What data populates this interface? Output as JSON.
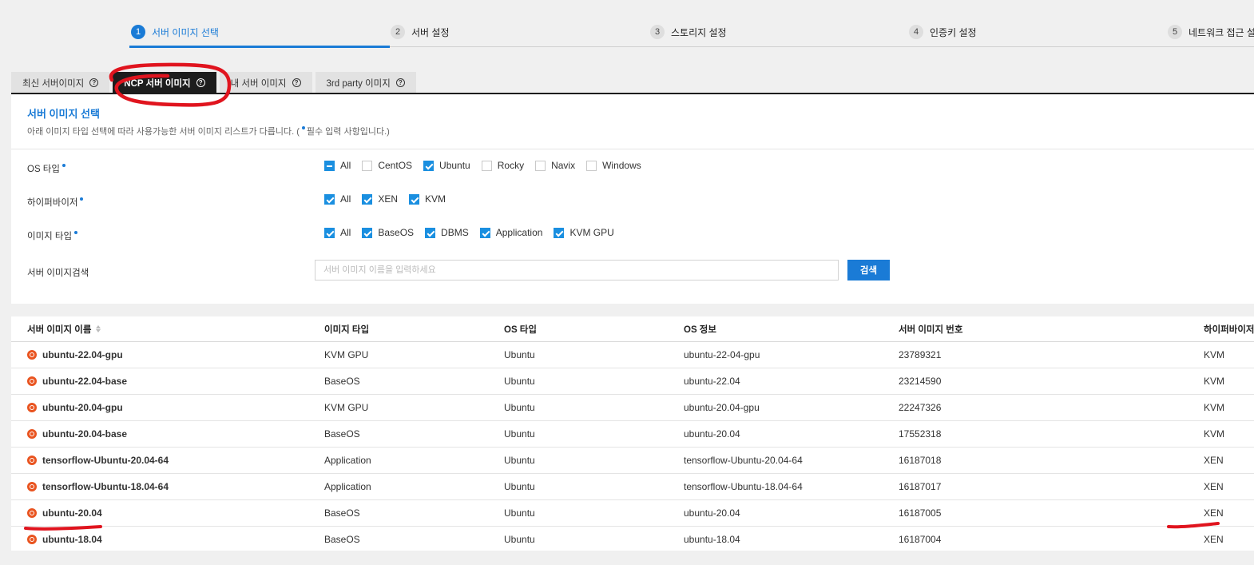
{
  "steps": [
    {
      "num": "1",
      "label": "서버 이미지 선택"
    },
    {
      "num": "2",
      "label": "서버 설정"
    },
    {
      "num": "3",
      "label": "스토리지 설정"
    },
    {
      "num": "4",
      "label": "인증키 설정"
    },
    {
      "num": "5",
      "label": "네트워크 접근 설정"
    }
  ],
  "tabs": [
    {
      "label": "최신 서버이미지"
    },
    {
      "label": "NCP 서버 이미지"
    },
    {
      "label": "내 서버 이미지"
    },
    {
      "label": "3rd party 이미지"
    }
  ],
  "panel": {
    "title": "서버 이미지 선택",
    "desc_prefix": "아래 이미지 타입 선택에 따라 사용가능한 서버 이미지 리스트가 다릅니다. (",
    "desc_suffix": "필수 입력 사항입니다.)"
  },
  "filters": {
    "os_type": {
      "label": "OS 타입",
      "options": [
        {
          "label": "All",
          "state": "partial"
        },
        {
          "label": "CentOS",
          "state": "off"
        },
        {
          "label": "Ubuntu",
          "state": "on"
        },
        {
          "label": "Rocky",
          "state": "off"
        },
        {
          "label": "Navix",
          "state": "off"
        },
        {
          "label": "Windows",
          "state": "off"
        }
      ]
    },
    "hypervisor": {
      "label": "하이퍼바이저",
      "options": [
        {
          "label": "All",
          "state": "on"
        },
        {
          "label": "XEN",
          "state": "on"
        },
        {
          "label": "KVM",
          "state": "on"
        }
      ]
    },
    "image_type": {
      "label": "이미지 타입",
      "options": [
        {
          "label": "All",
          "state": "on"
        },
        {
          "label": "BaseOS",
          "state": "on"
        },
        {
          "label": "DBMS",
          "state": "on"
        },
        {
          "label": "Application",
          "state": "on"
        },
        {
          "label": "KVM GPU",
          "state": "on"
        }
      ]
    },
    "search": {
      "label": "서버 이미지검색",
      "placeholder": "서버 이미지 이름을 입력하세요",
      "value": "",
      "button": "검색"
    }
  },
  "table": {
    "headers": [
      "서버 이미지 이름",
      "이미지 타입",
      "OS 타입",
      "OS 정보",
      "서버 이미지 번호",
      "하이퍼바이저"
    ],
    "rows": [
      [
        "ubuntu-22.04-gpu",
        "KVM GPU",
        "Ubuntu",
        "ubuntu-22-04-gpu",
        "23789321",
        "KVM"
      ],
      [
        "ubuntu-22.04-base",
        "BaseOS",
        "Ubuntu",
        "ubuntu-22.04",
        "23214590",
        "KVM"
      ],
      [
        "ubuntu-20.04-gpu",
        "KVM GPU",
        "Ubuntu",
        "ubuntu-20.04-gpu",
        "22247326",
        "KVM"
      ],
      [
        "ubuntu-20.04-base",
        "BaseOS",
        "Ubuntu",
        "ubuntu-20.04",
        "17552318",
        "KVM"
      ],
      [
        "tensorflow-Ubuntu-20.04-64",
        "Application",
        "Ubuntu",
        "tensorflow-Ubuntu-20.04-64",
        "16187018",
        "XEN"
      ],
      [
        "tensorflow-Ubuntu-18.04-64",
        "Application",
        "Ubuntu",
        "tensorflow-Ubuntu-18.04-64",
        "16187017",
        "XEN"
      ],
      [
        "ubuntu-20.04",
        "BaseOS",
        "Ubuntu",
        "ubuntu-20.04",
        "16187005",
        "XEN"
      ],
      [
        "ubuntu-18.04",
        "BaseOS",
        "Ubuntu",
        "ubuntu-18.04",
        "16187004",
        "XEN"
      ]
    ]
  },
  "colors": {
    "accent": "#1a7bd6",
    "ubuntu": "#e95420",
    "annotation": "#e0141e"
  }
}
